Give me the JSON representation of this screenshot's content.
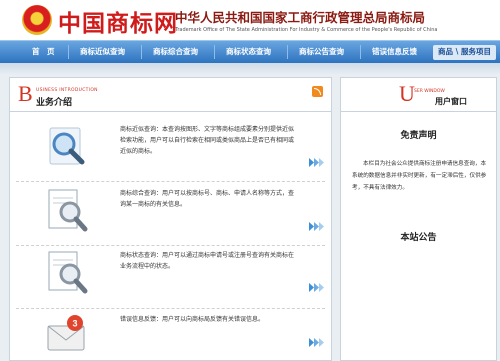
{
  "header": {
    "logo_text": "中国商标网",
    "title": "中华人民共和国国家工商行政管理总局商标局",
    "subtitle": "Trademark Office of The State Administration For Industry & Commerce of the People's Republic of China"
  },
  "nav": {
    "items": [
      "首　页",
      "商标近似查询",
      "商标综合查询",
      "商标状态查询",
      "商标公告查询",
      "错误信息反馈"
    ],
    "right_link": "商品 \\ 服务项目"
  },
  "main": {
    "big_letter": "B",
    "eng_label": "USINESS INTRODUCTION",
    "title": "业务介绍",
    "services": [
      {
        "icon": "magnifier-search-icon",
        "text": "商标近似查询：本查询按图形、文字等商标组成要素分别提供近似检索功能，用户可以自行检索在相同或类似商品上是否已有相同或近似的商标。"
      },
      {
        "icon": "document-magnifier-icon",
        "text": "商标综合查询：用户可以按商标号、商标、申请人名称等方式，查询某一商标的有关信息。"
      },
      {
        "icon": "document-magnifier-icon",
        "text": "商标状态查询：用户可以通过商标申请号或注册号查询有关商标在业务流程中的状态。"
      },
      {
        "icon": "mail-envelope-icon",
        "text": "错误信息反馈：用户可以向商标局反馈有关错误信息。"
      }
    ]
  },
  "side": {
    "big_letter": "U",
    "eng_label": "SER WINDOW",
    "title": "用户窗口",
    "disclaimer_title": "免责声明",
    "disclaimer_text": "本栏目为社会公众提供商标注册申请信息查询，本系统的数据信息并非实时更新，有一定滞后性，仅供参考，不具有法律效力。",
    "notice_title": "本站公告"
  },
  "colors": {
    "accent_red": "#d33524",
    "nav_blue": "#2d73c0",
    "arrow_blue": "#3d8fd8"
  }
}
